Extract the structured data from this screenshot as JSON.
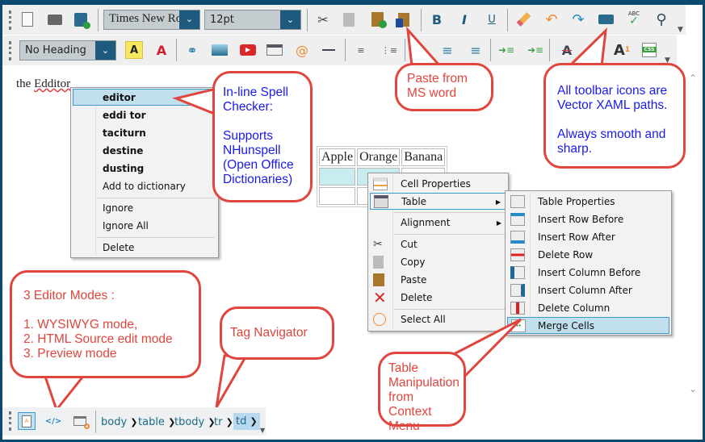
{
  "toolbar1": {
    "font": "Times New Roman",
    "size": "12pt",
    "icons": [
      "new-document-icon",
      "open-folder-icon",
      "save-icon",
      "cut-icon",
      "copy-icon",
      "paste-icon",
      "paste-from-word-icon",
      "bold-icon",
      "italic-icon",
      "underline-icon",
      "eraser-icon",
      "undo-icon",
      "redo-icon",
      "print-icon",
      "spellcheck-icon",
      "search-icon"
    ],
    "bold": "B",
    "italic": "I",
    "underline": "U",
    "abc": "ABC"
  },
  "toolbar2": {
    "heading": "No Heading",
    "css": "CSS",
    "icons": [
      "highlight-icon",
      "font-color-icon",
      "link-icon",
      "image-icon",
      "youtube-icon",
      "table-icon",
      "email-icon",
      "horizontal-line-icon",
      "ordered-list-icon",
      "unordered-list-icon",
      "align-left-icon",
      "align-center-icon",
      "align-right-icon",
      "indent-icon",
      "outdent-icon",
      "strikethrough-icon",
      "superscript-icon",
      "subscript-icon",
      "css-icon"
    ]
  },
  "editor": {
    "text_prefix": "the ",
    "misspelled": "Edditor",
    "table": {
      "headers": [
        "Apple",
        "Orange",
        "Banana"
      ]
    }
  },
  "spell_menu": {
    "suggestions": [
      "editor",
      "eddi tor",
      "taciturn",
      "destine",
      "dusting"
    ],
    "add": "Add to dictionary",
    "ignore": "Ignore",
    "ignore_all": "Ignore All",
    "delete": "Delete"
  },
  "context_menu": {
    "items": [
      "Cell Properties",
      "Table",
      "Alignment",
      "Cut",
      "Copy",
      "Paste",
      "Delete",
      "Select All"
    ]
  },
  "table_submenu": {
    "items": [
      "Table Properties",
      "Insert Row Before",
      "Insert Row After",
      "Delete Row",
      "Insert Column Before",
      "Insert Column After",
      "Delete Column",
      "Merge Cells"
    ]
  },
  "callouts": {
    "spell": "In-line Spell Checker:\n\nSupports NHunspell (Open Office Dictionaries)",
    "paste": "Paste from MS word",
    "vector": "All toolbar icons are Vector XAML paths.\n\nAlways smooth and sharp.",
    "modes": "3 Editor Modes :\n\n1. WYSIWYG mode,\n2. HTML Source edit mode\n3. Preview mode",
    "tagnav": "Tag Navigator",
    "tablemanip": "Table Manipulation from Context Menu"
  },
  "statusbar": {
    "modes": [
      "wysiwyg-mode-icon",
      "html-source-icon",
      "preview-icon"
    ],
    "source_label": "</>",
    "breadcrumbs": [
      "body",
      "table",
      "tbody",
      "tr",
      "td"
    ]
  },
  "colors": {
    "frame": "#0b4a6e",
    "callout_border": "#e0453e",
    "callout_text": "#1a1aee",
    "selection": "#c2dfee"
  }
}
